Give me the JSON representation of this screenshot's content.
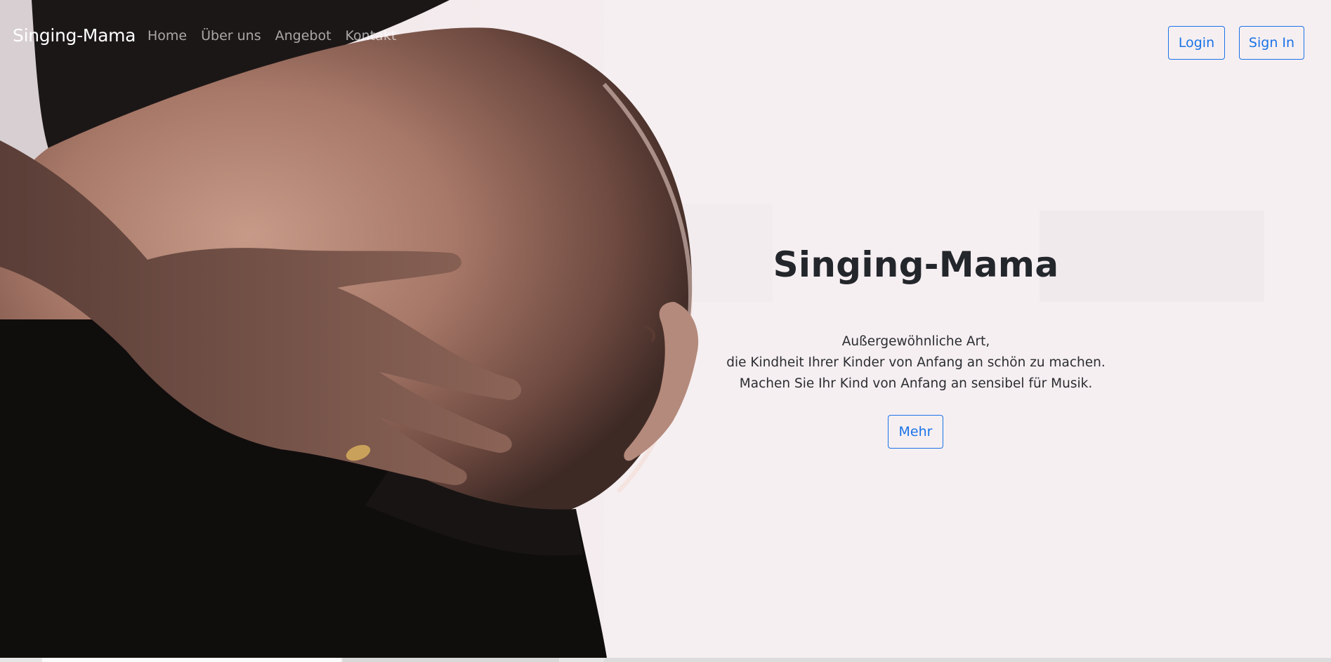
{
  "navbar": {
    "brand": "Singing-Mama",
    "links": [
      "Home",
      "Über uns",
      "Angebot",
      "Kontakt"
    ],
    "login_label": "Login",
    "signin_label": "Sign In"
  },
  "hero": {
    "title": "Singing-Mama",
    "lines": [
      "Außergewöhnliche Art,",
      "die Kindheit Ihrer Kinder von Anfang an schön zu machen.",
      "Machen Sie Ihr Kind von Anfang an sensibel für Musik."
    ],
    "cta_label": "Mehr",
    "background_image": "pregnant-belly-photo"
  },
  "colors": {
    "accent": "#1a73e8",
    "text_dark": "#23262b",
    "background_light": "#f4ecee"
  }
}
